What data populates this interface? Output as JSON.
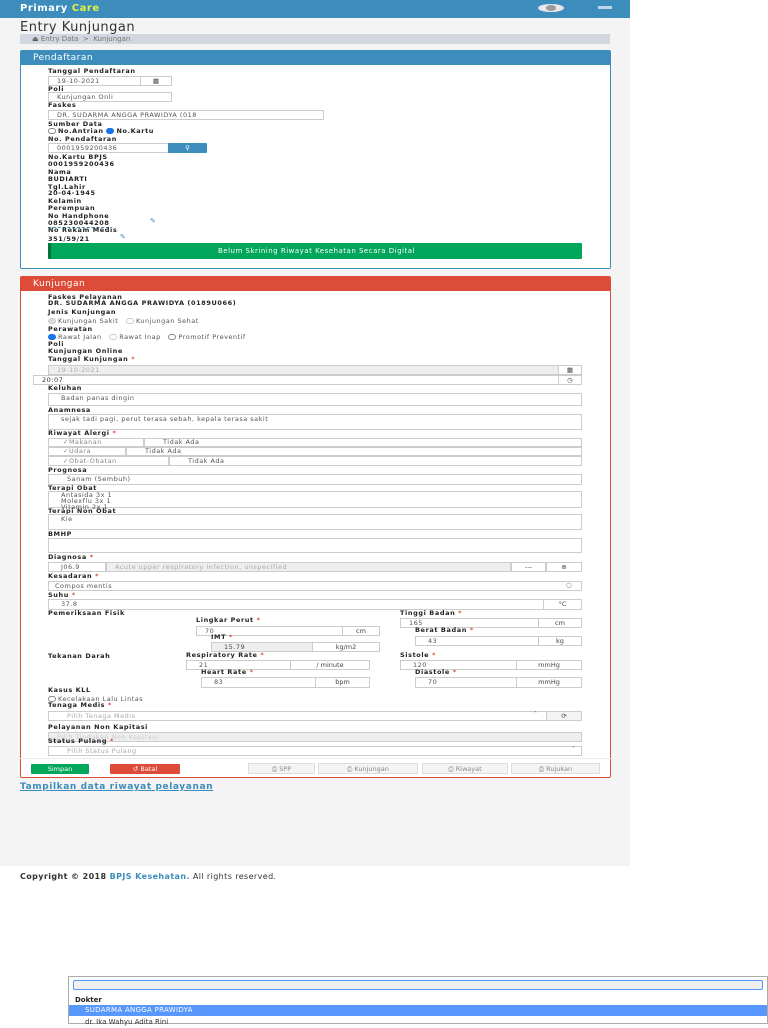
{
  "header": {
    "brand_primary": "Primary",
    "brand_care": "Care"
  },
  "page": {
    "title": "Entry Kunjungan",
    "breadcrumb": [
      "Entry Data",
      ">",
      "Kunjungan"
    ]
  },
  "pendaftaran": {
    "title": "Pendaftaran",
    "tanggal_label": "Tanggal Pendaftaran",
    "tanggal_value": "19-10-2021",
    "poli_label": "Poli",
    "poli_value": "Kunjungan Onli",
    "faskes_label": "Faskes",
    "faskes_value": "DR. SUDARMA ANGGA PRAWIDYA (018",
    "sumber_label": "Sumber Data",
    "sumber_options": [
      "No.Antrian",
      "No.Kartu"
    ],
    "nopendaftaran_label": "No. Pendaftaran",
    "nopendaftaran_value": "0001959200436",
    "nokartu_label": "No.Kartu BPJS",
    "nokartu_value": "0001959200436",
    "nama_label": "Nama",
    "nama_value": "BUDIARTI",
    "tgllahir_label": "Tgl.Lahir",
    "tgllahir_value": "20-04-1945",
    "kelamin_label": "Kelamin",
    "kelamin_value": "Perempuan",
    "hp_label": "No Handphone",
    "hp_value": "085230044208",
    "rm_label": "No Rekam Medis",
    "rm_value": "351/59/21",
    "skrining_button": "Belum Skrining Riwayat Kesehatan Secara Digital"
  },
  "kunjungan": {
    "title": "Kunjungan",
    "faskes_label": "Faskes Pelayanan",
    "faskes_value": "DR. SUDARMA ANGGA PRAWIDYA (0189U066)",
    "jenis_label": "Jenis Kunjungan",
    "jenis_options": [
      "Kunjungan Sakit",
      "Kunjungan Sehat"
    ],
    "perawatan_label": "Perawatan",
    "perawatan_options": [
      "Rawat Jalan",
      "Rawat Inap",
      "Promotif Preventif"
    ],
    "poli_label": "Poli",
    "poli_value": "Kunjungan Online",
    "tanggal_label": "Tanggal Kunjungan",
    "tanggal_value": "19-10-2021",
    "jam_value": "20:07",
    "keluhan_label": "Keluhan",
    "keluhan_value": "Badan panas dingin",
    "anamnesa_label": "Anamnesa",
    "anamnesa_value": "sejak tadi pagi, perut terasa sebah, kepala terasa sakit",
    "alergi_label": "Riwayat Alergi",
    "alergi": [
      {
        "type": "Makanan",
        "value": "Tidak Ada"
      },
      {
        "type": "Udara",
        "value": "Tidak Ada"
      },
      {
        "type": "Obat-Obatan",
        "value": "Tidak Ada"
      }
    ],
    "prognosa_label": "Prognosa",
    "prognosa_value": "Sanam (Sembuh)",
    "terapi_obat_label": "Terapi Obat",
    "terapi_obat_lines": [
      "Antasida 3x 1",
      "Molexflu 3x 1",
      "Vitamin 2x 1"
    ],
    "terapi_non_label": "Terapi Non Obat",
    "terapi_non_value": "Kie",
    "bmhp_label": "BMHP",
    "diagnosa_label": "Diagnosa",
    "diagnosa_code": "J06.9",
    "diagnosa_desc": "Acute upper respiratory infection, unspecified",
    "diagnosa_more": "---",
    "kesadaran_label": "Kesadaran",
    "kesadaran_value": "Compos mentis",
    "suhu_label": "Suhu",
    "suhu_value": "37.8",
    "suhu_unit": "°C",
    "fisik_label": "Pemeriksaan Fisik",
    "lingkar_label": "Lingkar Perut",
    "lingkar_value": "70",
    "lingkar_unit": "cm",
    "imt_label": "IMT",
    "imt_value": "15.79",
    "imt_unit": "kg/m2",
    "tinggi_label": "Tinggi Badan",
    "tinggi_value": "165",
    "tinggi_unit": "cm",
    "berat_label": "Berat Badan",
    "berat_value": "43",
    "berat_unit": "kg",
    "tekanan_label": "Tekanan Darah",
    "rr_label": "Respiratory Rate",
    "rr_value": "21",
    "rr_unit": "/ minute",
    "hr_label": "Heart Rate",
    "hr_value": "83",
    "hr_unit": "bpm",
    "sistole_label": "Sistole",
    "sistole_value": "120",
    "sistole_unit": "mmHg",
    "diastole_label": "Diastole",
    "diastole_value": "70",
    "diastole_unit": "mmHg",
    "kll_label": "Kasus KLL",
    "kll_option": "Kecelakaan Lalu Lintas",
    "tenaga_label": "Tenaga Medis",
    "tenaga_placeholder": "Pilih Tenaga Medis",
    "nonkap_label": "Pelayanan Non Kapitasi",
    "nonkap_placeholder": "Pilih Tindakan Non Kapitasi",
    "status_label": "Status Pulang",
    "status_placeholder": "Pilih Status Pulang",
    "buttons": {
      "simpan": "Simpan",
      "batal": "Batal",
      "spp": "SPP",
      "kunjungan": "Kunjungan",
      "riwayat": "Riwayat",
      "rujukan": "Rujukan"
    }
  },
  "link_riwayat": "Tampilkan data riwayat pelayanan",
  "footer": {
    "prefix": "Copyright © 2018 ",
    "org": "BPJS Kesehatan.",
    "suffix": " All rights reserved."
  },
  "dropdown": {
    "group": "Dokter",
    "options": [
      "SUDARMA ANGGA PRAWIDYA",
      "dr. Ika Wahyu Adita Rini"
    ],
    "selected_index": 0
  },
  "colors": {
    "primary": "#3c8dbc",
    "danger": "#dd4b39",
    "success": "#00a65a",
    "highlight": "#5897fb"
  }
}
